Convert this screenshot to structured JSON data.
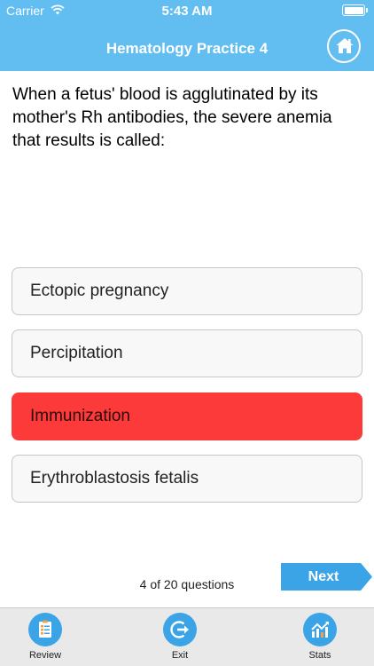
{
  "status_bar": {
    "carrier": "Carrier",
    "time": "5:43 AM"
  },
  "nav": {
    "title": "Hematology Practice 4"
  },
  "question": {
    "text": "When a fetus' blood is agglutinated by its mother's Rh antibodies, the severe anemia that results is called:"
  },
  "options": [
    {
      "label": "Ectopic pregnancy",
      "selected": false
    },
    {
      "label": "Percipitation",
      "selected": false
    },
    {
      "label": "Immunization",
      "selected": true
    },
    {
      "label": "Erythroblastosis fetalis",
      "selected": false
    }
  ],
  "progress": {
    "text": "4 of 20 questions"
  },
  "next_button": {
    "label": "Next"
  },
  "tabbar": {
    "items": [
      {
        "label": "Review",
        "icon": "review-clipboard-icon"
      },
      {
        "label": "Exit",
        "icon": "exit-icon"
      },
      {
        "label": "Stats",
        "icon": "stats-chart-icon"
      }
    ]
  },
  "colors": {
    "header": "#62bdf1",
    "selected_option": "#fd3a3a",
    "tab_icon": "#3ba4e6"
  }
}
